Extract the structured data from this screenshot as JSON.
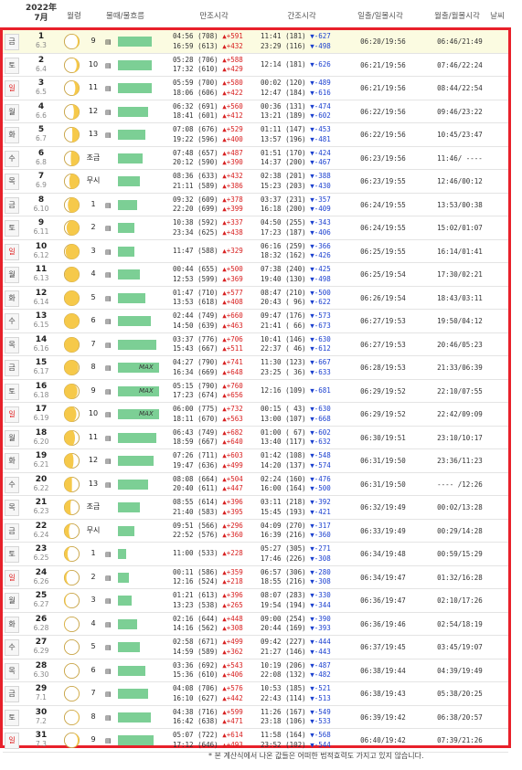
{
  "header": {
    "year_month": "2022年\n7月",
    "moon_phase": "월령",
    "tide": "물때/물흐름",
    "high_tide": "만조시각",
    "low_tide": "간조시각",
    "sunrise_sunset": "일출/일몰시각",
    "moonrise_moonset": "월출/월몰시각",
    "weather": "날씨"
  },
  "colors": {
    "highlight_row": "#fbfbe1",
    "bar": "#7ccf95",
    "up": "#d82020",
    "down": "#1a3fcf",
    "border": "#e8202a"
  },
  "rows": [
    {
      "dow": "금",
      "day": "1",
      "sub": "6.3",
      "tide": "9",
      "bar": 0.62,
      "hi1": "04:56 (708)",
      "hi1d": "▲+591",
      "hi2": "16:59 (613)",
      "hi2d": "▲+432",
      "lo1": "11:41 (181)",
      "lo1d": "▼-627",
      "lo2": "23:29 (116)",
      "lo2d": "▼-498",
      "sun": "06:20/19:56",
      "moon": "06:46/21:49",
      "phase": 1
    },
    {
      "dow": "토",
      "day": "2",
      "sub": "6.4",
      "tide": "10",
      "bar": 0.62,
      "hi1": "05:28 (706)",
      "hi1d": "▲+588",
      "hi2": "17:32 (610)",
      "hi2d": "▲+429",
      "lo1": "12:14 (181)",
      "lo1d": "▼-626",
      "lo2": "",
      "lo2d": "",
      "sun": "06:21/19:56",
      "moon": "07:46/22:24",
      "phase": 2
    },
    {
      "dow": "일",
      "day": "3",
      "sub": "6.5",
      "tide": "11",
      "bar": 0.62,
      "hi1": "05:59 (700)",
      "hi1d": "▲+580",
      "hi2": "18:06 (606)",
      "hi2d": "▲+422",
      "lo1": "00:02 (120)",
      "lo1d": "▼-489",
      "lo2": "12:47 (184)",
      "lo2d": "▼-616",
      "sun": "06:21/19:56",
      "moon": "08:44/22:54",
      "phase": 3
    },
    {
      "dow": "월",
      "day": "4",
      "sub": "6.6",
      "tide": "12",
      "bar": 0.55,
      "hi1": "06:32 (691)",
      "hi1d": "▲+560",
      "hi2": "18:41 (601)",
      "hi2d": "▲+412",
      "lo1": "00:36 (131)",
      "lo1d": "▼-474",
      "lo2": "13:21 (189)",
      "lo2d": "▼-602",
      "sun": "06:22/19:56",
      "moon": "09:46/23:22",
      "phase": 4
    },
    {
      "dow": "화",
      "day": "5",
      "sub": "6.7",
      "tide": "13",
      "bar": 0.5,
      "hi1": "07:08 (676)",
      "hi1d": "▲+529",
      "hi2": "19:22 (596)",
      "hi2d": "▲+400",
      "lo1": "01:11 (147)",
      "lo1d": "▼-453",
      "lo2": "13:57 (196)",
      "lo2d": "▼-481",
      "sun": "06:22/19:56",
      "moon": "10:45/23:47",
      "phase": 5
    },
    {
      "dow": "수",
      "day": "6",
      "sub": "6.8",
      "tide": "조금",
      "bar": 0.45,
      "hi1": "07:48 (657)",
      "hi1d": "▲+487",
      "hi2": "20:12 (590)",
      "hi2d": "▲+390",
      "lo1": "01:51 (170)",
      "lo1d": "▼-424",
      "lo2": "14:37 (200)",
      "lo2d": "▼-467",
      "sun": "06:23/19:56",
      "moon": "11:46/ ----",
      "phase": 6
    },
    {
      "dow": "목",
      "day": "7",
      "sub": "6.9",
      "tide": "무시",
      "bar": 0.4,
      "hi1": "08:36 (633)",
      "hi1d": "▲+432",
      "hi2": "21:11 (589)",
      "hi2d": "▲+386",
      "lo1": "02:38 (201)",
      "lo1d": "▼-388",
      "lo2": "15:23 (203)",
      "lo2d": "▼-430",
      "sun": "06:23/19:55",
      "moon": "12:46/00:12",
      "phase": 7
    },
    {
      "dow": "금",
      "day": "8",
      "sub": "6.10",
      "tide": "1",
      "bar": 0.35,
      "hi1": "09:32 (609)",
      "hi1d": "▲+378",
      "hi2": "22:20 (699)",
      "hi2d": "▲+399",
      "lo1": "03:37 (231)",
      "lo1d": "▼-357",
      "lo2": "16:18 (200)",
      "lo2d": "▼-409",
      "sun": "06:24/19:55",
      "moon": "13:53/00:38",
      "phase": 8
    },
    {
      "dow": "토",
      "day": "9",
      "sub": "6.11",
      "tide": "2",
      "bar": 0.3,
      "hi1": "10:38 (592)",
      "hi1d": "▲+337",
      "hi2": "23:34 (625)",
      "hi2d": "▲+438",
      "lo1": "04:50 (255)",
      "lo1d": "▼-343",
      "lo2": "17:23 (187)",
      "lo2d": "▼-406",
      "sun": "06:24/19:55",
      "moon": "15:02/01:07",
      "phase": 9
    },
    {
      "dow": "일",
      "day": "10",
      "sub": "6.12",
      "tide": "3",
      "bar": 0.3,
      "hi1": "11:47 (588)",
      "hi1d": "▲+329",
      "hi2": "",
      "hi2d": "",
      "lo1": "06:16 (259)",
      "lo1d": "▼-366",
      "lo2": "18:32 (162)",
      "lo2d": "▼-426",
      "sun": "06:25/19:55",
      "moon": "16:14/01:41",
      "phase": 10
    },
    {
      "dow": "월",
      "day": "11",
      "sub": "6.13",
      "tide": "4",
      "bar": 0.4,
      "hi1": "00:44 (655)",
      "hi1d": "▲+500",
      "hi2": "12:53 (599)",
      "hi2d": "▲+369",
      "lo1": "07:38 (240)",
      "lo1d": "▼-425",
      "lo2": "19:40 (130)",
      "lo2d": "▼-498",
      "sun": "06:25/19:54",
      "moon": "17:30/02:21",
      "phase": 11
    },
    {
      "dow": "화",
      "day": "12",
      "sub": "6.14",
      "tide": "5",
      "bar": 0.5,
      "hi1": "01:47 (710)",
      "hi1d": "▲+577",
      "hi2": "13:53 (618)",
      "hi2d": "▲+408",
      "lo1": "08:47 (210)",
      "lo1d": "▼-500",
      "lo2": "20:43 ( 96)",
      "lo2d": "▼-622",
      "sun": "06:26/19:54",
      "moon": "18:43/03:11",
      "phase": 12
    },
    {
      "dow": "수",
      "day": "13",
      "sub": "6.15",
      "tide": "6",
      "bar": 0.6,
      "hi1": "02:44 (749)",
      "hi1d": "▲+660",
      "hi2": "14:50 (639)",
      "hi2d": "▲+463",
      "lo1": "09:47 (176)",
      "lo1d": "▼-573",
      "lo2": "21:41 ( 66)",
      "lo2d": "▼-673",
      "sun": "06:27/19:53",
      "moon": "19:50/04:12",
      "phase": 13
    },
    {
      "dow": "목",
      "day": "14",
      "sub": "6.16",
      "tide": "7",
      "bar": 0.7,
      "hi1": "03:37 (776)",
      "hi1d": "▲+706",
      "hi2": "15:43 (667)",
      "hi2d": "▲+511",
      "lo1": "10:41 (146)",
      "lo1d": "▼-630",
      "lo2": "22:37 ( 46)",
      "lo2d": "▼-612",
      "sun": "06:27/19:53",
      "moon": "20:46/05:23",
      "phase": 14
    },
    {
      "dow": "금",
      "day": "15",
      "sub": "6.17",
      "tide": "8",
      "bar": 0.75,
      "max": true,
      "hi1": "04:27 (790)",
      "hi1d": "▲+741",
      "hi2": "16:34 (669)",
      "hi2d": "▲+648",
      "lo1": "11:30 (123)",
      "lo1d": "▼-667",
      "lo2": "23:25 ( 36)",
      "lo2d": "▼-633",
      "sun": "06:28/19:53",
      "moon": "21:33/06:39",
      "phase": 15
    },
    {
      "dow": "토",
      "day": "16",
      "sub": "6.18",
      "tide": "9",
      "bar": 0.75,
      "max": true,
      "hi1": "05:15 (790)",
      "hi1d": "▲+760",
      "hi2": "17:23 (674)",
      "hi2d": "▲+656",
      "lo1": "12:16 (109)",
      "lo1d": "▼-681",
      "lo2": "",
      "lo2d": "",
      "sun": "06:29/19:52",
      "moon": "22:10/07:55",
      "phase": 16
    },
    {
      "dow": "일",
      "day": "17",
      "sub": "6.19",
      "tide": "10",
      "bar": 0.75,
      "max": true,
      "hi1": "06:00 (775)",
      "hi1d": "▲+732",
      "hi2": "18:11 (670)",
      "hi2d": "▲+563",
      "lo1": "00:15 ( 43)",
      "lo1d": "▼-630",
      "lo2": "13:00 (107)",
      "lo2d": "▼-668",
      "sun": "06:29/19:52",
      "moon": "22:42/09:09",
      "phase": 17
    },
    {
      "dow": "월",
      "day": "18",
      "sub": "6.20",
      "tide": "11",
      "bar": 0.7,
      "hi1": "06:43 (749)",
      "hi1d": "▲+682",
      "hi2": "18:59 (667)",
      "hi2d": "▲+640",
      "lo1": "01:00 ( 67)",
      "lo1d": "▼-602",
      "lo2": "13:40 (117)",
      "lo2d": "▼-632",
      "sun": "06:30/19:51",
      "moon": "23:10/10:17",
      "phase": 18
    },
    {
      "dow": "화",
      "day": "19",
      "sub": "6.21",
      "tide": "12",
      "bar": 0.65,
      "hi1": "07:26 (711)",
      "hi1d": "▲+603",
      "hi2": "19:47 (636)",
      "hi2d": "▲+499",
      "lo1": "01:42 (108)",
      "lo1d": "▼-548",
      "lo2": "14:20 (137)",
      "lo2d": "▼-574",
      "sun": "06:31/19:50",
      "moon": "23:36/11:23",
      "phase": 19
    },
    {
      "dow": "수",
      "day": "20",
      "sub": "6.22",
      "tide": "13",
      "bar": 0.55,
      "hi1": "08:08 (664)",
      "hi1d": "▲+504",
      "hi2": "20:40 (611)",
      "hi2d": "▲+447",
      "lo1": "02:24 (160)",
      "lo1d": "▼-476",
      "lo2": "16:00 (164)",
      "lo2d": "▼-500",
      "sun": "06:31/19:50",
      "moon": "---- /12:26",
      "phase": 20
    },
    {
      "dow": "목",
      "day": "21",
      "sub": "6.23",
      "tide": "조금",
      "bar": 0.4,
      "hi1": "08:55 (614)",
      "hi1d": "▲+396",
      "hi2": "21:40 (583)",
      "hi2d": "▲+395",
      "lo1": "03:11 (218)",
      "lo1d": "▼-392",
      "lo2": "15:45 (193)",
      "lo2d": "▼-421",
      "sun": "06:32/19:49",
      "moon": "00:02/13:28",
      "phase": 21
    },
    {
      "dow": "금",
      "day": "22",
      "sub": "6.24",
      "tide": "무시",
      "bar": 0.3,
      "hi1": "09:51 (566)",
      "hi1d": "▲+296",
      "hi2": "22:52 (576)",
      "hi2d": "▲+360",
      "lo1": "04:09 (270)",
      "lo1d": "▼-317",
      "lo2": "16:39 (216)",
      "lo2d": "▼-360",
      "sun": "06:33/19:49",
      "moon": "00:29/14:28",
      "phase": 22
    },
    {
      "dow": "토",
      "day": "23",
      "sub": "6.25",
      "tide": "1",
      "bar": 0.15,
      "hi1": "11:00 (533)",
      "hi1d": "▲+228",
      "hi2": "",
      "hi2d": "",
      "lo1": "05:27 (305)",
      "lo1d": "▼-271",
      "lo2": "17:46 (226)",
      "lo2d": "▼-308",
      "sun": "06:34/19:48",
      "moon": "00:59/15:29",
      "phase": 23
    },
    {
      "dow": "일",
      "day": "24",
      "sub": "6.26",
      "tide": "2",
      "bar": 0.2,
      "hi1": "00:11 (586)",
      "hi1d": "▲+359",
      "hi2": "12:16 (524)",
      "hi2d": "▲+218",
      "lo1": "06:57 (306)",
      "lo1d": "▼-280",
      "lo2": "18:55 (216)",
      "lo2d": "▼-308",
      "sun": "06:34/19:47",
      "moon": "01:32/16:28",
      "phase": 24
    },
    {
      "dow": "월",
      "day": "25",
      "sub": "6.27",
      "tide": "3",
      "bar": 0.25,
      "hi1": "01:21 (613)",
      "hi1d": "▲+396",
      "hi2": "13:23 (538)",
      "hi2d": "▲+265",
      "lo1": "08:07 (283)",
      "lo1d": "▼-330",
      "lo2": "19:54 (194)",
      "lo2d": "▼-344",
      "sun": "06:36/19:47",
      "moon": "02:10/17:26",
      "phase": 25
    },
    {
      "dow": "화",
      "day": "26",
      "sub": "6.28",
      "tide": "4",
      "bar": 0.35,
      "hi1": "02:16 (644)",
      "hi1d": "▲+448",
      "hi2": "14:16 (562)",
      "hi2d": "▲+308",
      "lo1": "09:00 (254)",
      "lo1d": "▼-390",
      "lo2": "20:44 (169)",
      "lo2d": "▼-393",
      "sun": "06:36/19:46",
      "moon": "02:54/18:19",
      "phase": 26
    },
    {
      "dow": "수",
      "day": "27",
      "sub": "6.29",
      "tide": "5",
      "bar": 0.4,
      "hi1": "02:58 (671)",
      "hi1d": "▲+499",
      "hi2": "14:59 (589)",
      "hi2d": "▲+362",
      "lo1": "09:42 (227)",
      "lo1d": "▼-444",
      "lo2": "21:27 (146)",
      "lo2d": "▼-443",
      "sun": "06:37/19:45",
      "moon": "03:45/19:07",
      "phase": 27
    },
    {
      "dow": "목",
      "day": "28",
      "sub": "6.30",
      "tide": "6",
      "bar": 0.5,
      "hi1": "03:36 (692)",
      "hi1d": "▲+543",
      "hi2": "15:36 (610)",
      "hi2d": "▲+406",
      "lo1": "10:19 (206)",
      "lo1d": "▼-487",
      "lo2": "22:08 (132)",
      "lo2d": "▼-482",
      "sun": "06:38/19:44",
      "moon": "04:39/19:49",
      "phase": 28
    },
    {
      "dow": "금",
      "day": "29",
      "sub": "7.1",
      "tide": "7",
      "bar": 0.55,
      "hi1": "04:08 (706)",
      "hi1d": "▲+576",
      "hi2": "16:10 (627)",
      "hi2d": "▲+442",
      "lo1": "10:53 (185)",
      "lo1d": "▼-521",
      "lo2": "22:43 (114)",
      "lo2d": "▼-513",
      "sun": "06:38/19:43",
      "moon": "05:38/20:25",
      "phase": 29
    },
    {
      "dow": "토",
      "day": "30",
      "sub": "7.2",
      "tide": "8",
      "bar": 0.6,
      "hi1": "04:38 (716)",
      "hi1d": "▲+599",
      "hi2": "16:42 (638)",
      "hi2d": "▲+471",
      "lo1": "11:26 (167)",
      "lo1d": "▼-549",
      "lo2": "23:18 (106)",
      "lo2d": "▼-533",
      "sun": "06:39/19:42",
      "moon": "06:38/20:57",
      "phase": 30
    },
    {
      "dow": "일",
      "day": "31",
      "sub": "7.3",
      "tide": "9",
      "bar": 0.65,
      "hi1": "05:07 (722)",
      "hi1d": "▲+614",
      "hi2": "17:12 (646)",
      "hi2d": "▲+493",
      "lo1": "11:58 (164)",
      "lo1d": "▼-568",
      "lo2": "23:52 (102)",
      "lo2d": "▼-544",
      "sun": "06:40/19:42",
      "moon": "07:39/21:26",
      "phase": 31
    }
  ],
  "footer": "* 본 계산식에서 나온 값들은 어떠한 법적효력도 가지고 있지 않습니다."
}
